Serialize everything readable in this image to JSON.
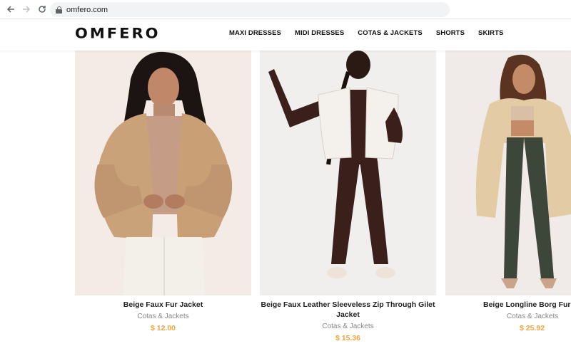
{
  "browser": {
    "url": "omfero.com"
  },
  "site": {
    "logo": "OMFERO",
    "menu": [
      "MAXI DRESSES",
      "MIDI DRESSES",
      "COTAS & JACKETS",
      "SHORTS",
      "SKIRTS"
    ]
  },
  "products": [
    {
      "name": "Beige Faux Fur Jacket",
      "category": "Cotas & Jackets",
      "price": "$ 12.00"
    },
    {
      "name": "Beige Faux Leather Sleeveless Zip Through Gilet Jacket",
      "category": "Cotas & Jackets",
      "price": "$ 15.36"
    },
    {
      "name": "Beige Longline Borg Fur C",
      "category": "Cotas & Jackets",
      "price": "$ 25.92"
    }
  ],
  "colors": {
    "price": "#f2a33c",
    "text": "#222222",
    "muted": "#888888"
  },
  "icons": [
    "back-arrow-icon",
    "forward-arrow-icon",
    "reload-icon",
    "lock-icon"
  ]
}
